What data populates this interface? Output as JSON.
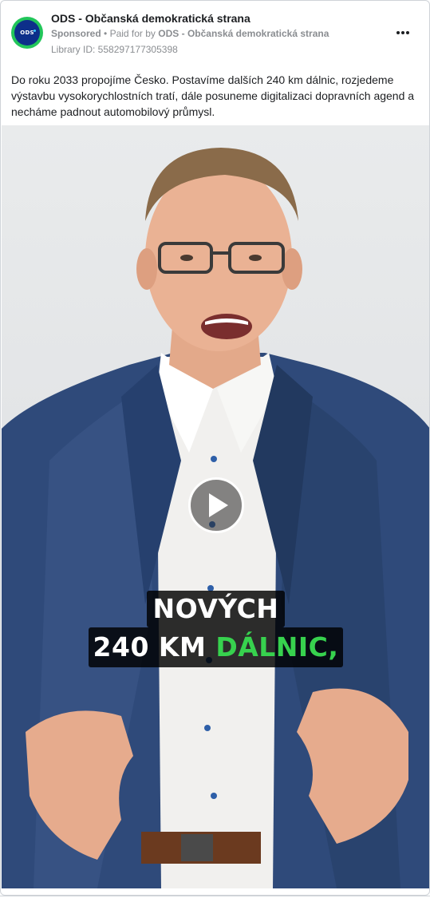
{
  "ad": {
    "page_name": "ODS - Občanská demokratická strana",
    "sponsored_label": "Sponsored",
    "paid_for_prefix": "Paid for by",
    "paid_for_name": "ODS - Občanská demokratická strana",
    "library_id": "Library ID: 558297177305398",
    "avatar_text": "ODS",
    "body": "Do roku 2033 propojíme Česko. Postavíme dalších 240 km dálnic, rozjedeme výstavbu vysokorychlostních tratí, dále posuneme digitalizaci dopravních agend a necháme padnout automobilový průmysl."
  },
  "video": {
    "caption_line1": "NOVÝCH",
    "caption_line2_white": "240 KM",
    "caption_line2_green": "DÁLNIC,",
    "play_icon": "play-icon"
  },
  "colors": {
    "brand_green": "#22c65a",
    "brand_blue": "#0d2f8a",
    "caption_green": "#37d24e"
  }
}
